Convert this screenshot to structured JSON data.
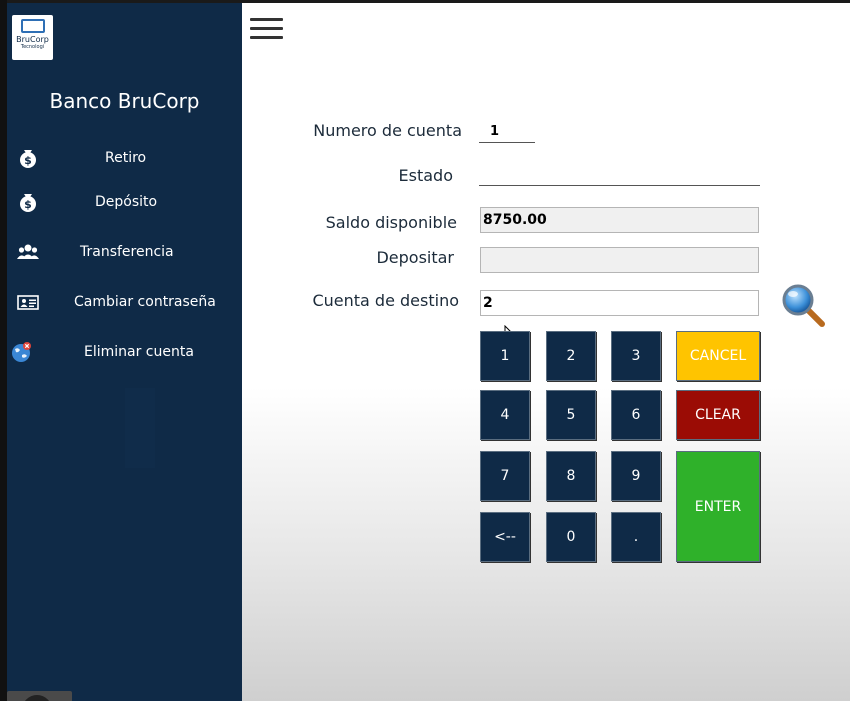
{
  "sidebar": {
    "logo_line1": "BruCorp",
    "logo_line2": "Tecnologi",
    "brand": "Banco BruCorp",
    "items": [
      {
        "label": "Retiro",
        "icon": "money-bag-icon"
      },
      {
        "label": "Depósito",
        "icon": "money-bag-icon"
      },
      {
        "label": "Transferencia",
        "icon": "users-icon"
      },
      {
        "label": "Cambiar contraseña",
        "icon": "id-card-icon"
      },
      {
        "label": "Eliminar cuenta",
        "icon": "globe-remove-icon"
      }
    ]
  },
  "form": {
    "numero_label": "Numero de cuenta",
    "numero_value": "1",
    "estado_label": "Estado",
    "estado_value": "",
    "saldo_label": "Saldo disponible",
    "saldo_value": "8750.00",
    "depositar_label": "Depositar",
    "depositar_value": "",
    "destino_label": "Cuenta de destino",
    "destino_value": "2"
  },
  "keypad": {
    "k1": "1",
    "k2": "2",
    "k3": "3",
    "k4": "4",
    "k5": "5",
    "k6": "6",
    "k7": "7",
    "k8": "8",
    "k9": "9",
    "back": "<--",
    "k0": "0",
    "dot": ".",
    "cancel": "CANCEL",
    "clear": "CLEAR",
    "enter": "ENTER"
  },
  "colors": {
    "sidebar": "#0f2a47",
    "cancel": "#ffc400",
    "clear": "#9b0c05",
    "enter": "#2fb12a"
  }
}
